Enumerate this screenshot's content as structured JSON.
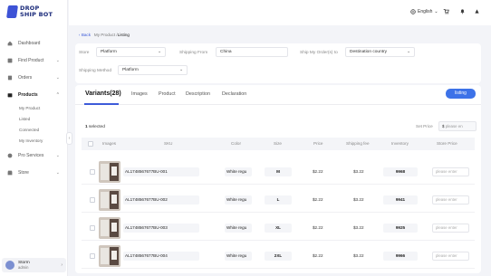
{
  "brand": {
    "line1": "DROP",
    "line2": "SHIP BOT"
  },
  "sidebar": {
    "items": [
      {
        "label": "Dashboard",
        "icon": "home-icon"
      },
      {
        "label": "Find Product",
        "icon": "search-icon"
      },
      {
        "label": "Orders",
        "icon": "orders-icon"
      },
      {
        "label": "Products",
        "icon": "products-icon"
      },
      {
        "label": "Pro Services",
        "icon": "services-icon"
      },
      {
        "label": "Store",
        "icon": "store-icon"
      }
    ],
    "sub_items": [
      "My Product",
      "Listed",
      "Connected",
      "My Inventory"
    ],
    "user": {
      "name": "Storm",
      "role": "admin"
    }
  },
  "topbar": {
    "language": "English"
  },
  "breadcrumb": {
    "back": "Back",
    "parent": "My Product",
    "current": "Listing"
  },
  "filters": {
    "store_label": "Store",
    "store_value": "Platform",
    "ship_from_label": "Shipping From",
    "ship_from_value": "China",
    "ship_to_label": "Ship My Order(s) to",
    "ship_to_value": "Destination country",
    "method_label": "Shipping Method",
    "method_value": "Platform"
  },
  "tabs": [
    "Variants(28)",
    "Images",
    "Product",
    "Description",
    "Declaration"
  ],
  "listing_button": "listing",
  "selection": {
    "count": "1",
    "text": "selected"
  },
  "set_price": {
    "label": "Set Price",
    "currency": "$",
    "placeholder": "please en"
  },
  "table": {
    "headers": [
      "Images",
      "SKU",
      "Color",
      "Size",
      "Price",
      "Shipping fee",
      "Inventory",
      "Store Price"
    ],
    "rows": [
      {
        "sku": "AL1748567677BU-001",
        "color": "White regu",
        "size": "M",
        "price": "$2.22",
        "shipping": "$3.22",
        "inventory": "9968",
        "store_price_placeholder": "please enter"
      },
      {
        "sku": "AL1748567677BU-002",
        "color": "White regu",
        "size": "L",
        "price": "$2.22",
        "shipping": "$3.22",
        "inventory": "9941",
        "store_price_placeholder": "please enter"
      },
      {
        "sku": "AL1748567677BU-003",
        "color": "White regu",
        "size": "XL",
        "price": "$2.22",
        "shipping": "$3.22",
        "inventory": "9925",
        "store_price_placeholder": "please enter"
      },
      {
        "sku": "AL1748567677BU-004",
        "color": "White regu",
        "size": "2XL",
        "price": "$2.22",
        "shipping": "$3.22",
        "inventory": "9966",
        "store_price_placeholder": "please enter"
      }
    ]
  },
  "colors": {
    "accent": "#3d72e8",
    "brand": "#3d53d6"
  }
}
